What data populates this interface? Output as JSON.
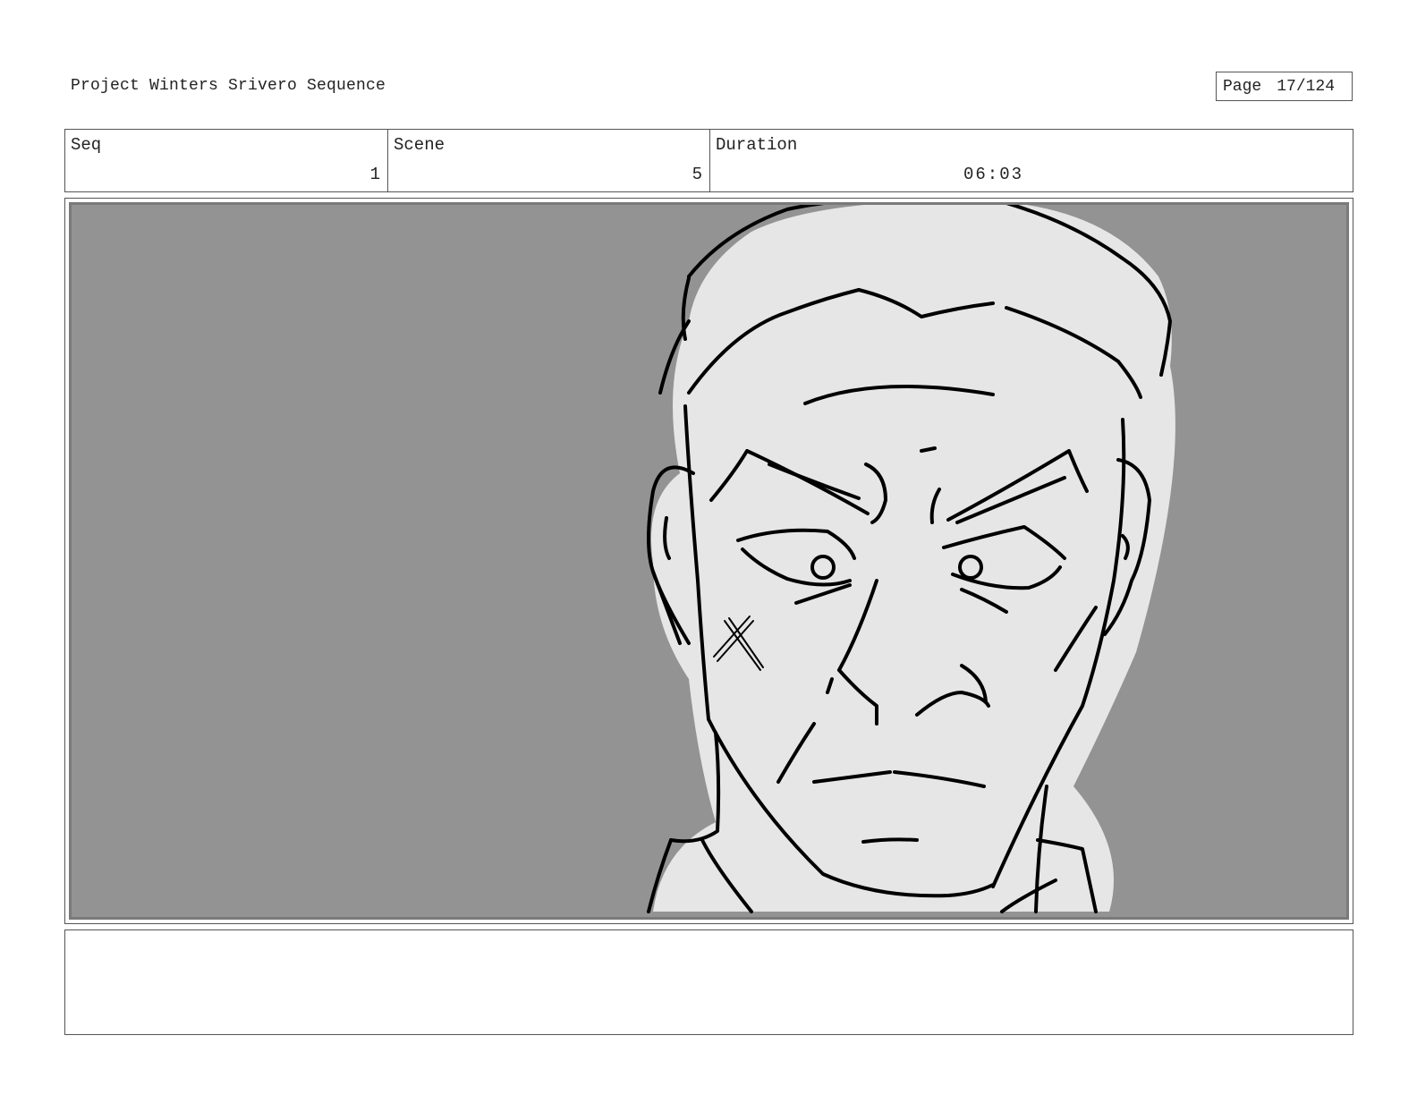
{
  "header": {
    "project_title": "Project Winters Srivero Sequence",
    "page_label": "Page",
    "page_number": "17/124"
  },
  "info": {
    "seq_label": "Seq",
    "seq_value": "1",
    "scene_label": "Scene",
    "scene_value": "5",
    "duration_label": "Duration",
    "duration_value": "06:03"
  },
  "panel": {
    "background_color": "#939393",
    "skin_color": "#e6e6e6",
    "line_color": "#000000"
  },
  "notes": {
    "text": ""
  }
}
